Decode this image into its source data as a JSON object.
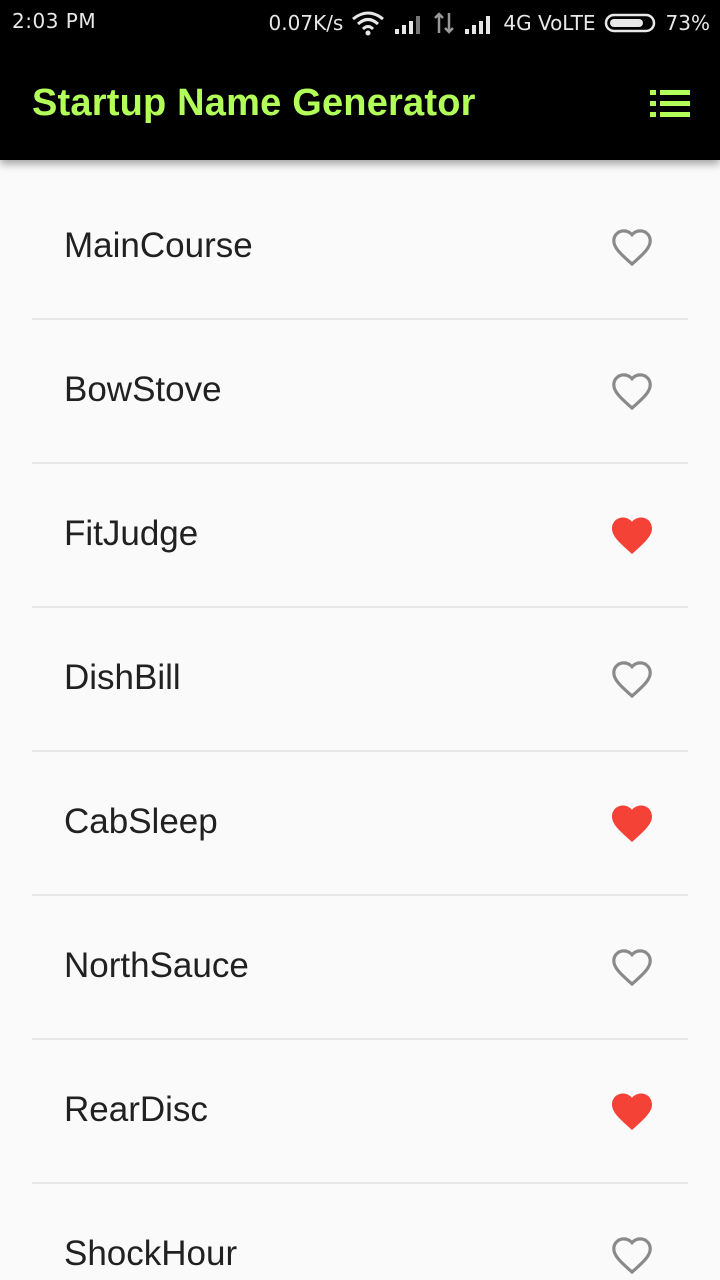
{
  "status_bar": {
    "time": "2:03 PM",
    "net_speed": "0.07K/s",
    "network": "4G VoLTE",
    "battery": "73%"
  },
  "app_bar": {
    "title": "Startup Name Generator",
    "title_color": "#b2ff59",
    "action_icon": "list-icon"
  },
  "names": [
    {
      "label": "MainCourse",
      "saved": false
    },
    {
      "label": "BowStove",
      "saved": false
    },
    {
      "label": "FitJudge",
      "saved": true
    },
    {
      "label": "DishBill",
      "saved": false
    },
    {
      "label": "CabSleep",
      "saved": true
    },
    {
      "label": "NorthSauce",
      "saved": false
    },
    {
      "label": "RearDisc",
      "saved": true
    },
    {
      "label": "ShockHour",
      "saved": false
    }
  ],
  "colors": {
    "heart_saved": "#f44336",
    "heart_outline": "#8a8a8a"
  }
}
